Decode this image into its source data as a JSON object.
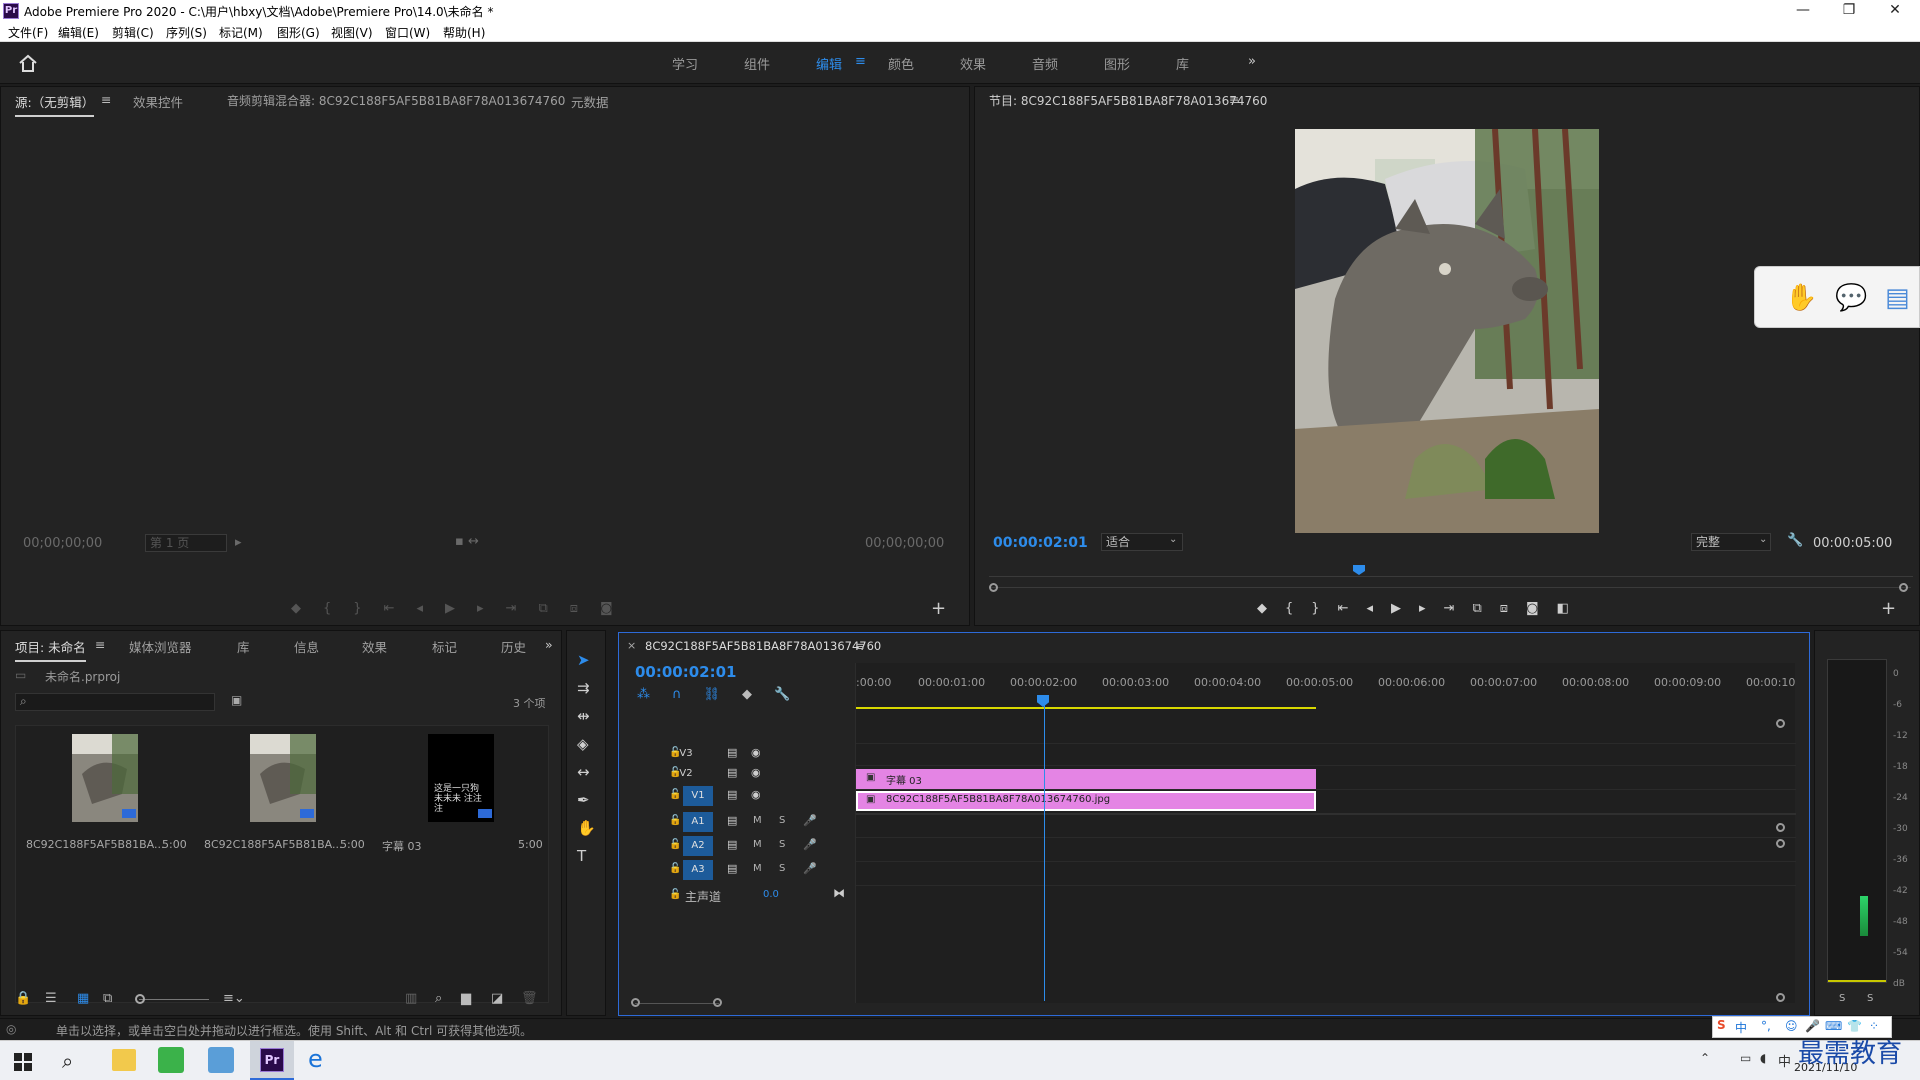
{
  "window": {
    "app_icon": "Pr",
    "title": "Adobe Premiere Pro 2020 - C:\\用户\\hbxy\\文档\\Adobe\\Premiere Pro\\14.0\\未命名 *",
    "minimize": "—",
    "restore": "❐",
    "close": "✕"
  },
  "menu": [
    "文件(F)",
    "编辑(E)",
    "剪辑(C)",
    "序列(S)",
    "标记(M)",
    "图形(G)",
    "视图(V)",
    "窗口(W)",
    "帮助(H)"
  ],
  "workspaces": {
    "items": [
      "学习",
      "组件",
      "编辑",
      "颜色",
      "效果",
      "音频",
      "图形",
      "库"
    ],
    "active": "编辑",
    "more": "»"
  },
  "source_panel": {
    "tabs": [
      "源:（无剪辑）",
      "效果控件",
      "音频剪辑混合器: 8C92C188F5AF5B81BA8F78A013674760",
      "元数据"
    ],
    "timecode_left": "00;00;00;00",
    "timecode_right": "00;00;00;00",
    "page_select": "第 1 页"
  },
  "program_panel": {
    "title": "节目: 8C92C188F5AF5B81BA8F78A013674760",
    "timecode": "00:00:02:01",
    "fit": "适合",
    "quality": "完整",
    "duration": "00:00:05:00"
  },
  "project_panel": {
    "tabs": [
      "项目: 未命名",
      "媒体浏览器",
      "库",
      "信息",
      "效果",
      "标记",
      "历史"
    ],
    "file": "未命名.prproj",
    "count": "3 个项",
    "items": [
      {
        "name": "8C92C188F5AF5B81BA...",
        "duration": "5:00"
      },
      {
        "name": "8C92C188F5AF5B81BA...",
        "duration": "5:00"
      },
      {
        "name": "字幕 03",
        "duration": "5:00",
        "thumb_text": "这是一只狗 未未未 注注注"
      }
    ]
  },
  "timeline": {
    "sequence_name": "8C92C188F5AF5B81BA8F78A013674760",
    "timecode": "00:00:02:01",
    "ruler": [
      ":00:00",
      "00:00:01:00",
      "00:00:02:00",
      "00:00:03:00",
      "00:00:04:00",
      "00:00:05:00",
      "00:00:06:00",
      "00:00:07:00",
      "00:00:08:00",
      "00:00:09:00",
      "00:00:10"
    ],
    "video_tracks": [
      "V3",
      "V2",
      "V1"
    ],
    "audio_tracks": [
      "A1",
      "A2",
      "A3"
    ],
    "master_label": "主声道",
    "master_value": "0.0",
    "clips": {
      "v2": "字幕 03",
      "v1": "8C92C188F5AF5B81BA8F78A013674760.jpg"
    },
    "mute": "M",
    "solo": "S"
  },
  "audio_meter": {
    "scale": [
      "0",
      "-6",
      "-12",
      "-18",
      "-24",
      "-30",
      "-36",
      "-42",
      "-48",
      "-54",
      "dB"
    ],
    "solo_labels": [
      "S",
      "S"
    ]
  },
  "status_bar": "单击以选择，或单击空白处并拖动以进行框选。使用 Shift、Alt 和 Ctrl 可获得其他选项。",
  "taskbar": {
    "ime": "中",
    "date": "2021/11/10",
    "watermark": "最需教育"
  },
  "colors": {
    "accent_blue": "#2d8ceb",
    "clip_pink": "#e484e4",
    "panel_bg": "#232323"
  }
}
